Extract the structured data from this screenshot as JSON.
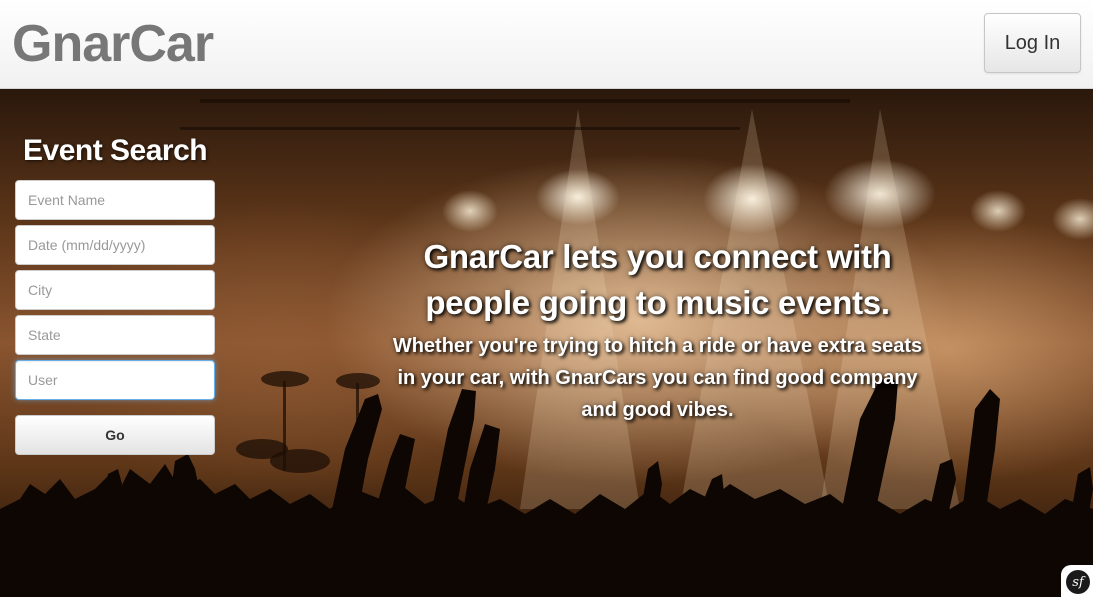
{
  "navbar": {
    "brand": "GnarCar",
    "login_label": "Log In"
  },
  "search": {
    "title": "Event Search",
    "fields": [
      {
        "placeholder": "Event Name",
        "value": ""
      },
      {
        "placeholder": "Date (mm/dd/yyyy)",
        "value": ""
      },
      {
        "placeholder": "City",
        "value": ""
      },
      {
        "placeholder": "State",
        "value": ""
      },
      {
        "placeholder": "User",
        "value": ""
      }
    ],
    "go_label": "Go"
  },
  "hero": {
    "headline_line1": "GnarCar lets you connect with",
    "headline_line2": "people going to music events.",
    "subline_line1": "Whether you're trying to hitch a ride or have extra seats",
    "subline_line2": "in your car, with GnarCars you can find good company",
    "subline_line3": "and good vibes."
  },
  "badge": {
    "icon": "symfony-icon",
    "text": "sf"
  },
  "colors": {
    "brand_text": "#777777",
    "hero_tint": "#8a5530",
    "focus_ring": "#66afe9"
  }
}
